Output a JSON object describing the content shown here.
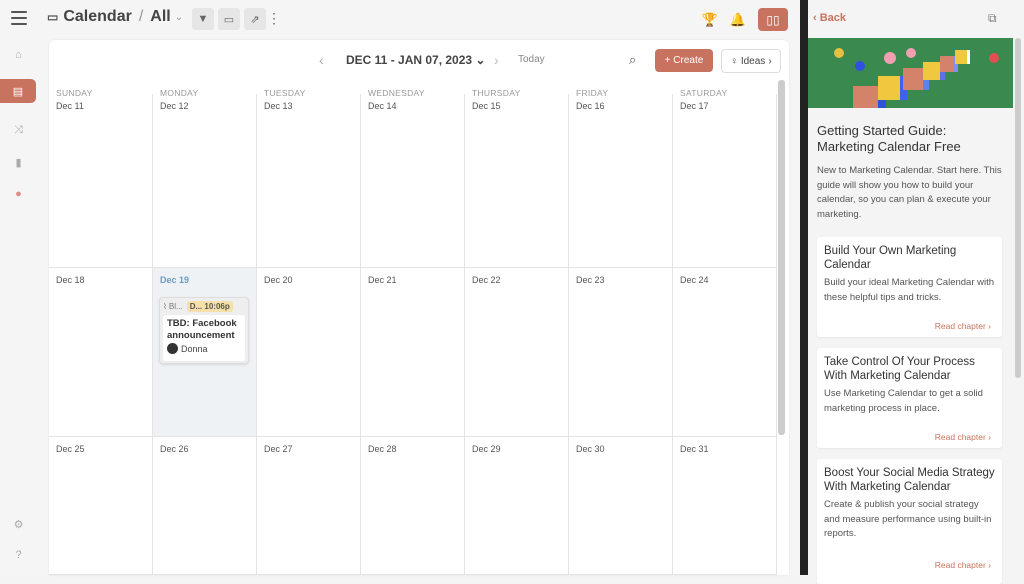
{
  "header": {
    "title": "Calendar",
    "view": "All",
    "icons": [
      "menu-icon",
      "calendar-icon",
      "filter-icon",
      "display-icon",
      "share-icon",
      "more-icon",
      "trophy-icon",
      "bell-icon",
      "book-icon"
    ]
  },
  "sidebar": {
    "items": [
      {
        "name": "home",
        "icon": "⌂"
      },
      {
        "name": "calendar",
        "icon": "▤",
        "active": true
      },
      {
        "name": "shuffle",
        "icon": "⤨"
      },
      {
        "name": "analytics",
        "icon": "▮"
      },
      {
        "name": "record",
        "icon": "●"
      }
    ],
    "bottom": [
      {
        "name": "settings",
        "icon": "⚙"
      },
      {
        "name": "help",
        "icon": "?"
      }
    ]
  },
  "calendar": {
    "range": "DEC 11 - JAN 07, 2023",
    "today": "Today",
    "create": "+ Create",
    "ideas": "Ideas",
    "days": [
      "SUNDAY",
      "MONDAY",
      "TUESDAY",
      "WEDNESDAY",
      "THURSDAY",
      "FRIDAY",
      "SATURDAY"
    ],
    "weeks": [
      [
        "Dec 11",
        "Dec 12",
        "Dec 13",
        "Dec 14",
        "Dec 15",
        "Dec 16",
        "Dec 17"
      ],
      [
        "Dec 18",
        "Dec 19",
        "Dec 20",
        "Dec 21",
        "Dec 22",
        "Dec 23",
        "Dec 24"
      ],
      [
        "Dec 25",
        "Dec 26",
        "Dec 27",
        "Dec 28",
        "Dec 29",
        "Dec 30",
        "Dec 31"
      ]
    ],
    "highlighted": "Dec 19",
    "event": {
      "channel": "Bl...",
      "tag": "D...",
      "time": "10:06p",
      "title": "TBD: Facebook announcement",
      "user": "Donna"
    }
  },
  "panel": {
    "back": "Back",
    "title": "Getting Started Guide: Marketing Calendar Free",
    "desc": "New to Marketing Calendar. Start here. This guide will show you how to build your calendar, so you can plan & execute your marketing.",
    "chapters": [
      {
        "title": "Build Your Own Marketing Calendar",
        "desc": "Build your ideal Marketing Calendar with these helpful tips and tricks.",
        "link": "Read chapter ›"
      },
      {
        "title": "Take Control Of Your Process With Marketing Calendar",
        "desc": "Use Marketing Calendar to get a solid marketing process in place.",
        "link": "Read chapter ›"
      },
      {
        "title": "Boost Your Social Media Strategy With Marketing Calendar",
        "desc": "Create & publish your social strategy and measure performance using built-in reports.",
        "link": "Read chapter ›"
      }
    ]
  }
}
